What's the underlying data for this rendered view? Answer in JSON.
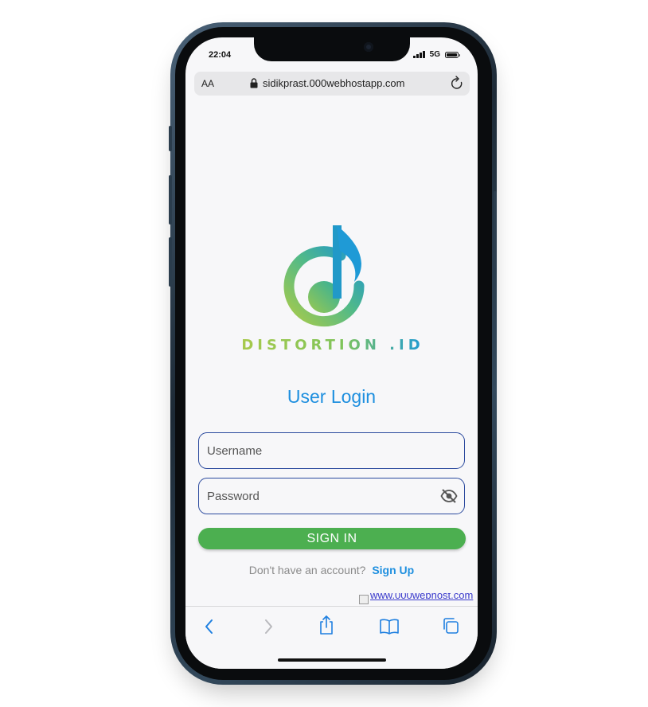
{
  "status_bar": {
    "time": "22:04",
    "network": "5G"
  },
  "browser": {
    "text_size_control": "AA",
    "url": "sidikprast.000webhostapp.com",
    "icons": {
      "lock": "lock-icon",
      "reload": "reload-icon",
      "back": "back-icon",
      "forward": "forward-icon",
      "share": "share-icon",
      "bookmarks": "bookmarks-icon",
      "tabs": "tabs-icon"
    }
  },
  "logo": {
    "text": "DISTORTION .ID",
    "icon": "music-note-d-logo"
  },
  "login": {
    "title": "User Login",
    "username_placeholder": "Username",
    "password_placeholder": "Password",
    "username_value": "",
    "password_value": "",
    "password_toggle_icon": "eye-off-icon",
    "signin_label": "SIGN IN",
    "signup_prompt": "Don't have an account?",
    "signup_link": "Sign Up"
  },
  "footer_badge": {
    "alt_text": "www.000webhost.com"
  },
  "colors": {
    "accent_blue": "#1e8fdf",
    "signin_green": "#4caf50",
    "field_border": "#2b4a9e",
    "logo_gradient_start": "#a7c94b",
    "logo_gradient_end": "#1f9ad6"
  }
}
